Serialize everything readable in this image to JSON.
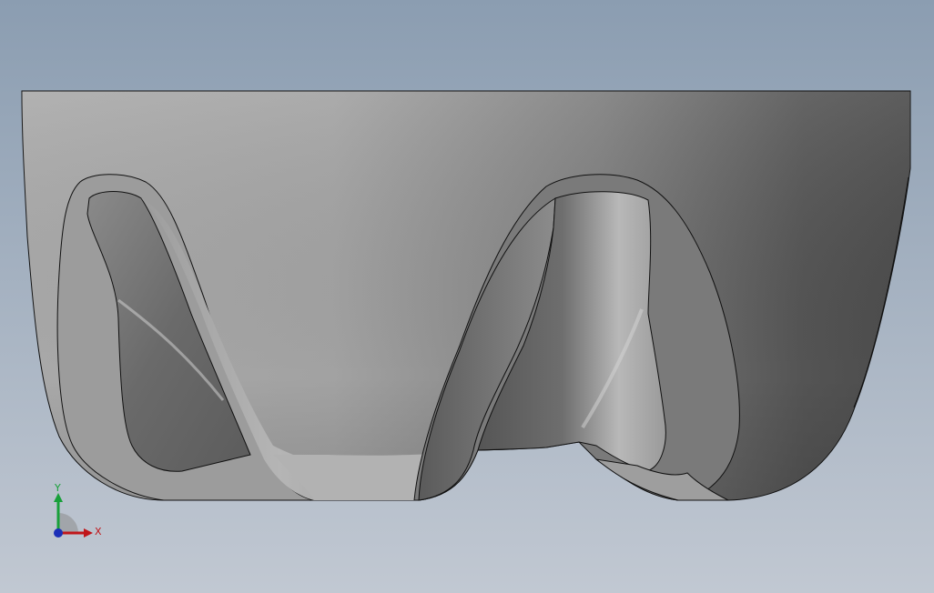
{
  "viewport": {
    "background_top": "#8b9db1",
    "background_bottom": "#c1c8d2"
  },
  "model": {
    "edge_color": "#111111",
    "face_light": "#b4b4b4",
    "face_dark": "#4a4a4a"
  },
  "triad": {
    "x_label": "X",
    "y_label": "Y",
    "x_color": "#c0161a",
    "y_color": "#18a03a",
    "z_color": "#1b2fb8"
  }
}
